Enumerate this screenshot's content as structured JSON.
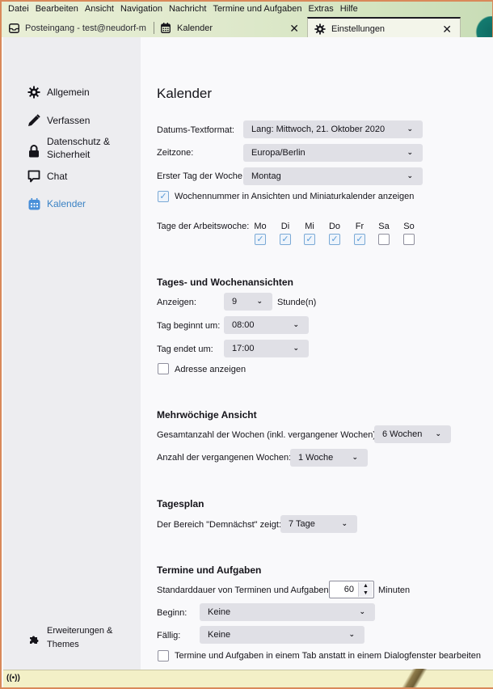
{
  "menubar": {
    "items": [
      "Datei",
      "Bearbeiten",
      "Ansicht",
      "Navigation",
      "Nachricht",
      "Termine und Aufgaben",
      "Extras",
      "Hilfe"
    ]
  },
  "tabs": [
    {
      "label": "Posteingang - test@neudorf-m",
      "icon": "inbox-icon",
      "active": false,
      "closable": false
    },
    {
      "label": "Kalender",
      "icon": "calendar-icon",
      "active": false,
      "closable": true
    },
    {
      "label": "Einstellungen",
      "icon": "gear-icon",
      "active": true,
      "closable": true
    }
  ],
  "sidebar": {
    "items": [
      {
        "label": "Allgemein",
        "icon": "gear-icon",
        "active": false
      },
      {
        "label": "Verfassen",
        "icon": "pencil-icon",
        "active": false
      },
      {
        "label_line1": "Datenschutz &",
        "label_line2": "Sicherheit",
        "icon": "lock-icon",
        "active": false
      },
      {
        "label": "Chat",
        "icon": "chat-icon",
        "active": false
      },
      {
        "label": "Kalender",
        "icon": "calendar-icon",
        "active": true
      }
    ],
    "footer": {
      "label_line1": "Erweiterungen &",
      "label_line2": "Themes",
      "icon": "puzzle-icon"
    }
  },
  "main": {
    "title": "Kalender",
    "general": {
      "date_format_label": "Datums-Textformat:",
      "date_format_value": "Lang: Mittwoch, 21. Oktober 2020",
      "timezone_label": "Zeitzone:",
      "timezone_value": "Europa/Berlin",
      "first_day_label": "Erster Tag der Woche:",
      "first_day_value": "Montag",
      "week_number_label": "Wochennummer in Ansichten und Miniaturkalender anzeigen",
      "week_number_checked": true,
      "workdays_label": "Tage der Arbeitswoche:",
      "workdays": [
        {
          "label": "Mo",
          "checked": true
        },
        {
          "label": "Di",
          "checked": true
        },
        {
          "label": "Mi",
          "checked": true
        },
        {
          "label": "Do",
          "checked": true
        },
        {
          "label": "Fr",
          "checked": true
        },
        {
          "label": "Sa",
          "checked": false
        },
        {
          "label": "So",
          "checked": false
        }
      ]
    },
    "day_week": {
      "title": "Tages- und Wochenansichten",
      "show_label": "Anzeigen:",
      "show_value": "9",
      "show_unit": "Stunde(n)",
      "day_start_label": "Tag beginnt um:",
      "day_start_value": "08:00",
      "day_end_label": "Tag endet um:",
      "day_end_value": "17:00",
      "show_location_label": "Adresse anzeigen",
      "show_location_checked": false
    },
    "multiweek": {
      "title": "Mehrwöchige Ansicht",
      "total_weeks_label": "Gesamtanzahl der Wochen (inkl. vergangener Wochen):",
      "total_weeks_value": "6 Wochen",
      "past_weeks_label": "Anzahl der vergangenen Wochen:",
      "past_weeks_value": "1 Woche"
    },
    "agenda": {
      "title": "Tagesplan",
      "upcoming_label": "Der Bereich \"Demnächst\" zeigt:",
      "upcoming_value": "7 Tage"
    },
    "events": {
      "title": "Termine und Aufgaben",
      "default_length_label": "Standarddauer von Terminen und Aufgaben:",
      "default_length_value": "60",
      "default_length_unit": "Minuten",
      "start_label": "Beginn:",
      "start_value": "Keine",
      "due_label": "Fällig:",
      "due_value": "Keine",
      "edit_in_tab_label": "Termine und Aufgaben in einem Tab anstatt in einem Dialogfenster bearbeiten",
      "edit_in_tab_checked": false
    }
  },
  "statusbar": {
    "icon": "online-status-icon"
  },
  "colors": {
    "accent": "#3b82c4",
    "select_bg": "#e0e0e6",
    "sidebar_bg": "#ededf0",
    "statusbar_bg": "#f3f0c7",
    "frame": "#d9895a"
  }
}
